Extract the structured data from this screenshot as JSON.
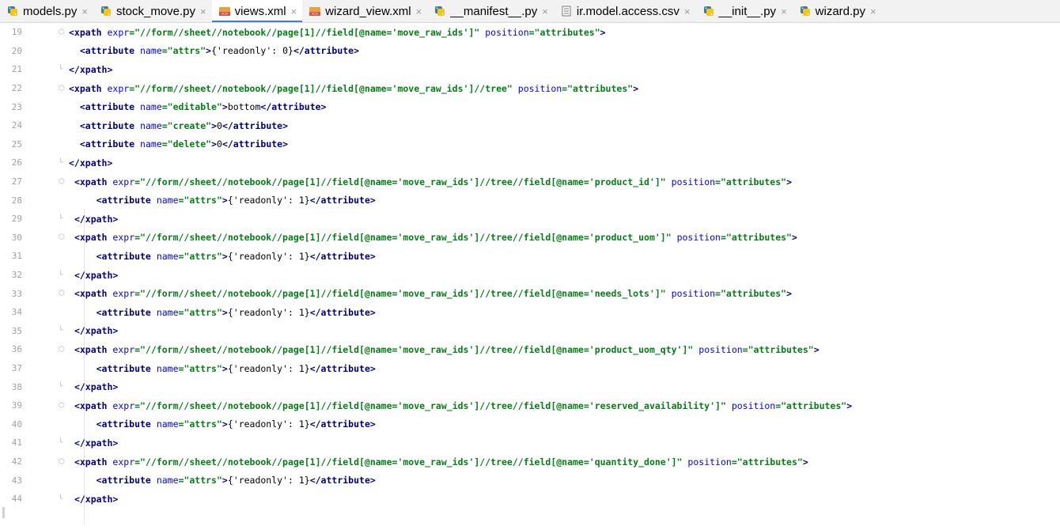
{
  "tabs": [
    {
      "label": "models.py",
      "icon": "python-file-icon",
      "active": false
    },
    {
      "label": "stock_move.py",
      "icon": "python-file-icon",
      "active": false
    },
    {
      "label": "views.xml",
      "icon": "xml-file-icon",
      "active": true
    },
    {
      "label": "wizard_view.xml",
      "icon": "xml-file-icon",
      "active": false
    },
    {
      "label": "__manifest__.py",
      "icon": "python-file-icon",
      "active": false
    },
    {
      "label": "ir.model.access.csv",
      "icon": "csv-file-icon",
      "active": false
    },
    {
      "label": "__init__.py",
      "icon": "python-file-icon",
      "active": false
    },
    {
      "label": "wizard.py",
      "icon": "python-file-icon",
      "active": false
    }
  ],
  "close_glyph": "×",
  "editor": {
    "lines": [
      {
        "n": "19",
        "text": "<xpath expr=\"//form//sheet//notebook//page[1]//field[@name='move_raw_ids']\" position=\"attributes\">"
      },
      {
        "n": "20",
        "text": "  <attribute name=\"attrs\">{'readonly': 0}</attribute>"
      },
      {
        "n": "21",
        "text": "</xpath>"
      },
      {
        "n": "22",
        "text": "<xpath expr=\"//form//sheet//notebook//page[1]//field[@name='move_raw_ids']//tree\" position=\"attributes\">"
      },
      {
        "n": "23",
        "text": "  <attribute name=\"editable\">bottom</attribute>"
      },
      {
        "n": "24",
        "text": "  <attribute name=\"create\">0</attribute>"
      },
      {
        "n": "25",
        "text": "  <attribute name=\"delete\">0</attribute>"
      },
      {
        "n": "26",
        "text": "</xpath>"
      },
      {
        "n": "27",
        "text": " <xpath expr=\"//form//sheet//notebook//page[1]//field[@name='move_raw_ids']//tree//field[@name='product_id']\" position=\"attributes\">"
      },
      {
        "n": "28",
        "text": "     <attribute name=\"attrs\">{'readonly': 1}</attribute>"
      },
      {
        "n": "29",
        "text": " </xpath>"
      },
      {
        "n": "30",
        "text": " <xpath expr=\"//form//sheet//notebook//page[1]//field[@name='move_raw_ids']//tree//field[@name='product_uom']\" position=\"attributes\">"
      },
      {
        "n": "31",
        "text": "     <attribute name=\"attrs\">{'readonly': 1}</attribute>"
      },
      {
        "n": "32",
        "text": " </xpath>"
      },
      {
        "n": "33",
        "text": " <xpath expr=\"//form//sheet//notebook//page[1]//field[@name='move_raw_ids']//tree//field[@name='needs_lots']\" position=\"attributes\">"
      },
      {
        "n": "34",
        "text": "     <attribute name=\"attrs\">{'readonly': 1}</attribute>"
      },
      {
        "n": "35",
        "text": " </xpath>"
      },
      {
        "n": "36",
        "text": " <xpath expr=\"//form//sheet//notebook//page[1]//field[@name='move_raw_ids']//tree//field[@name='product_uom_qty']\" position=\"attributes\">"
      },
      {
        "n": "37",
        "text": "     <attribute name=\"attrs\">{'readonly': 1}</attribute>"
      },
      {
        "n": "38",
        "text": " </xpath>"
      },
      {
        "n": "39",
        "text": " <xpath expr=\"//form//sheet//notebook//page[1]//field[@name='move_raw_ids']//tree//field[@name='reserved_availability']\" position=\"attributes\">"
      },
      {
        "n": "40",
        "text": "     <attribute name=\"attrs\">{'readonly': 1}</attribute>"
      },
      {
        "n": "41",
        "text": " </xpath>"
      },
      {
        "n": "42",
        "text": " <xpath expr=\"//form//sheet//notebook//page[1]//field[@name='move_raw_ids']//tree//field[@name='quantity_done']\" position=\"attributes\">"
      },
      {
        "n": "43",
        "text": "     <attribute name=\"attrs\">{'readonly': 1}</attribute>"
      },
      {
        "n": "44",
        "text": " </xpath>"
      }
    ]
  },
  "colors": {
    "tag": "#000080",
    "attribute_name": "#0000ff",
    "string": "#067d17",
    "active_tab_underline": "#4083c9",
    "line_number": "#a0a0a0"
  }
}
